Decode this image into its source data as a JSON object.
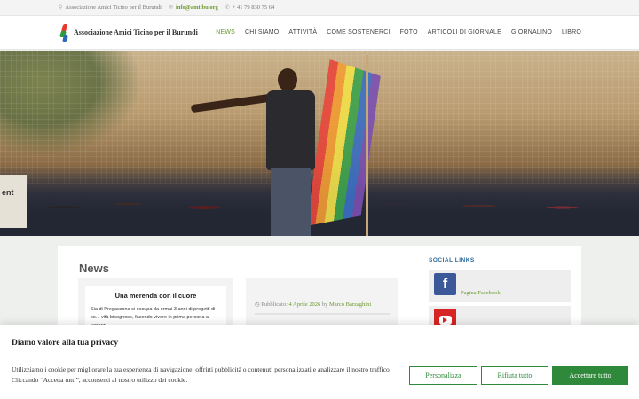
{
  "topbar": {
    "org": "Associazione Amici Ticino per il Burundi",
    "email": "info@amtibu.org",
    "phone": "+ 41 79 830 75 64",
    "icons": [
      "map-marker-icon",
      "envelope-icon",
      "phone-icon"
    ]
  },
  "header": {
    "logo_text": "Associazione Amici Ticino per il Burundi",
    "nav": [
      "NEWS",
      "CHI SIAMO",
      "ATTIVITÀ",
      "COME SOSTENERCI",
      "FOTO",
      "ARTICOLI DI GIORNALE",
      "GIORNALINO",
      "LIBRO"
    ],
    "active_nav": "NEWS"
  },
  "hero": {
    "box_text": "ent"
  },
  "main": {
    "title": "News",
    "card1": {
      "title": "Una merenda con il cuore",
      "body": "Sia di Pregassona si occupa da ormai 3 anni di progetti di so... vità bisognose, facendo vivere in prima persona ai ragazzi"
    },
    "card2": {
      "published_label": "Pubblicato:",
      "date": "4 Aprile 2026",
      "by": "by",
      "author": "Marco Barzaghini"
    }
  },
  "sidebar": {
    "heading": "SOCIAL LINKS",
    "items": [
      {
        "label": "Pagina Facebook",
        "icon": "facebook-icon"
      },
      {
        "label": "",
        "icon": "youtube-icon"
      }
    ]
  },
  "cookie": {
    "title": "Diamo valore alla tua privacy",
    "body": "Utilizziamo i cookie per migliorare la tua esperienza di navigazione, offrirti pubblicità o contenuti personalizzati e analizzare il nostro traffico. Cliccando “Accetta tutti”, acconsenti al nostro utilizzo dei cookie.",
    "btn_customize": "Personalizza",
    "btn_reject": "Rifiuta tutto",
    "btn_accept": "Accettare tutto"
  },
  "colors": {
    "accent_green": "#6a9a2e",
    "button_green": "#2e8a3a",
    "facebook_blue": "#3b5998",
    "youtube_red": "#d62424"
  }
}
